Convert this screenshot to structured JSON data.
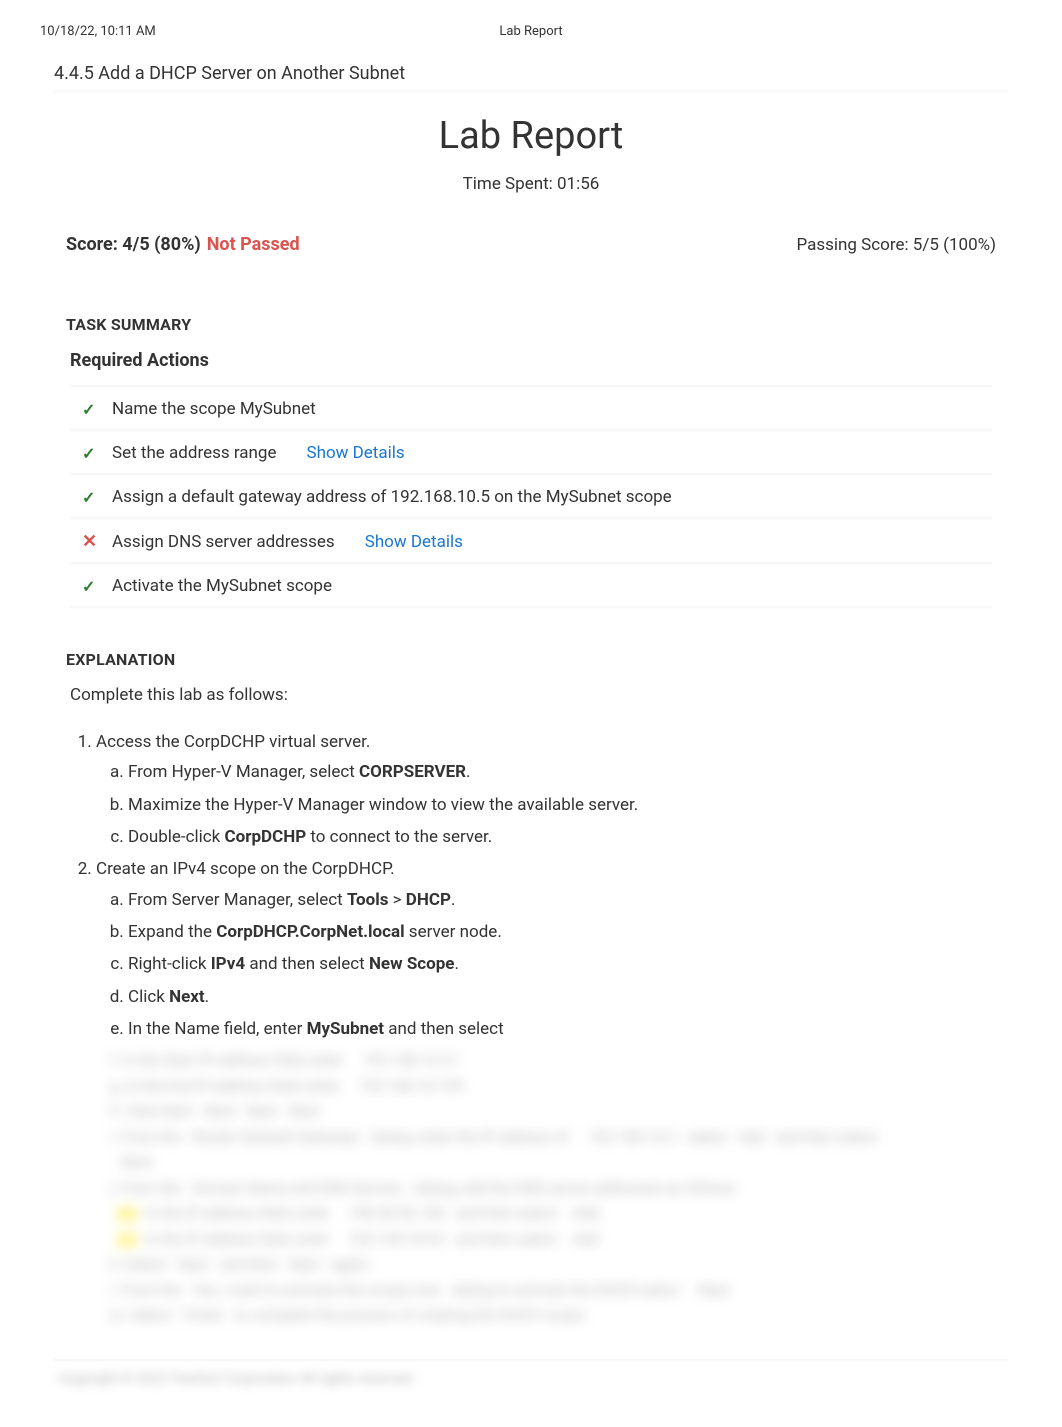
{
  "header": {
    "timestamp": "10/18/22, 10:11 AM",
    "title": "Lab Report"
  },
  "lab_title": "4.4.5 Add a DHCP Server on Another Subnet",
  "main_title": "Lab Report",
  "time_spent": "Time Spent: 01:56",
  "score": {
    "label": "Score: 4/5 (80%)",
    "status": "Not Passed",
    "passing": "Passing Score: 5/5 (100%)"
  },
  "task_summary_heading": "TASK SUMMARY",
  "required_actions_heading": "Required Actions",
  "actions": [
    {
      "status": "pass",
      "text": "Name the scope MySubnet",
      "details": false
    },
    {
      "status": "pass",
      "text": "Set the address range",
      "details": true
    },
    {
      "status": "pass",
      "text": "Assign a default gateway address of 192.168.10.5 on the MySubnet scope",
      "details": false
    },
    {
      "status": "fail",
      "text": "Assign DNS server addresses",
      "details": true
    },
    {
      "status": "pass",
      "text": "Activate the MySubnet scope",
      "details": false
    }
  ],
  "show_details_label": "Show Details",
  "explanation_heading": "EXPLANATION",
  "explanation_intro": "Complete this lab as follows:",
  "steps": {
    "s1": {
      "text": "Access the CorpDCHP virtual server.",
      "a": {
        "pre": "From Hyper-V Manager, select ",
        "bold": "CORPSERVER",
        "post": "."
      },
      "b": "Maximize the Hyper-V Manager window to view the available server.",
      "c": {
        "pre": "Double-click ",
        "bold": "CorpDCHP",
        "post": " to connect to the server."
      }
    },
    "s2": {
      "text": "Create an IPv4 scope on the CorpDHCP.",
      "a": {
        "pre": "From Server Manager, select ",
        "bold1": "Tools",
        "mid": " > ",
        "bold2": "DHCP",
        "post": "."
      },
      "b": {
        "pre": "Expand the ",
        "bold": "CorpDHCP.CorpNet.local",
        "post": " server node."
      },
      "c": {
        "pre": "Right-click ",
        "bold1": "IPv4",
        "mid": " and then select ",
        "bold2": "New Scope",
        "post": "."
      },
      "d": {
        "pre": "Click ",
        "bold": "Next",
        "post": "."
      },
      "e": {
        "pre": "In the Name field, enter ",
        "bold": "MySubnet",
        "post": " and then select "
      }
    }
  }
}
